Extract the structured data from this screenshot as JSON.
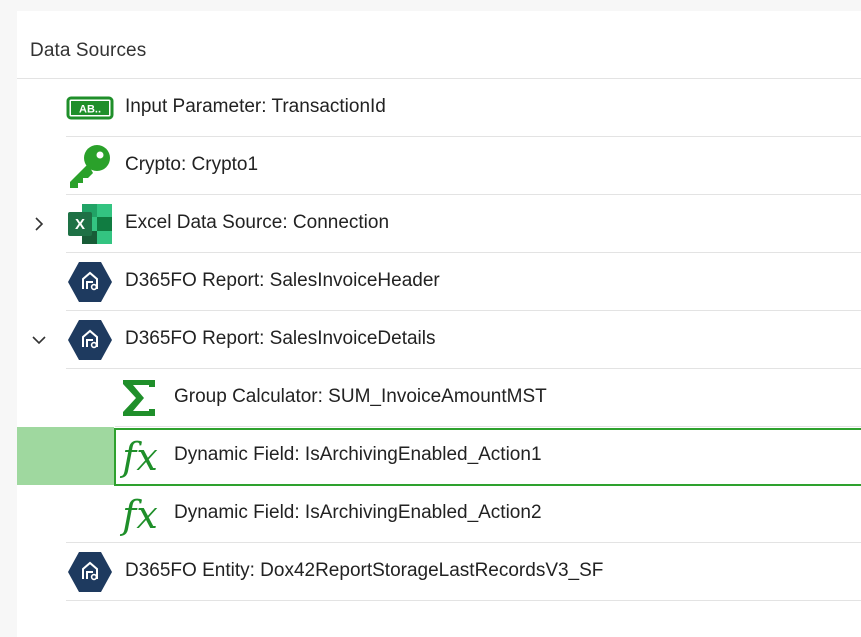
{
  "panel": {
    "title": "Data Sources"
  },
  "items": [
    {
      "label": "Input Parameter: TransactionId",
      "icon": "text-parameter-icon"
    },
    {
      "label": "Crypto: Crypto1",
      "icon": "key-icon"
    },
    {
      "label": "Excel Data Source: Connection",
      "icon": "excel-icon",
      "expander": "collapsed"
    },
    {
      "label": "D365FO Report: SalesInvoiceHeader",
      "icon": "d365-report-icon"
    },
    {
      "label": "D365FO Report: SalesInvoiceDetails",
      "icon": "d365-report-icon",
      "expander": "expanded"
    },
    {
      "label": "Group Calculator: SUM_InvoiceAmountMST",
      "icon": "sigma-icon"
    },
    {
      "label": "Dynamic Field: IsArchivingEnabled_Action1",
      "icon": "function-icon",
      "selected": true
    },
    {
      "label": "Dynamic Field: IsArchivingEnabled_Action2",
      "icon": "function-icon"
    },
    {
      "label": "D365FO Entity: Dox42ReportStorageLastRecordsV3_SF",
      "icon": "d365-entity-icon"
    }
  ],
  "icon_text": {
    "parameter": "AB..",
    "excel": "X",
    "function": "fx"
  },
  "colors": {
    "accent_green": "#2ea12e",
    "selection_fill": "#9fd89f",
    "d365_hexagon": "#1e3a5f",
    "excel_green": "#1e7145"
  }
}
